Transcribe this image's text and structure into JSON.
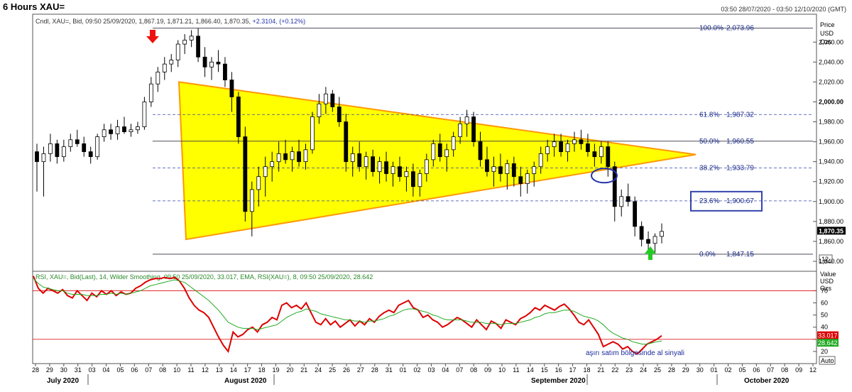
{
  "header": {
    "title": "6 Hours XAU=",
    "date_range": "03:50 28/07/2020 - 03:50 12/10/2020 (GMT)"
  },
  "chart_data": [
    {
      "type": "candlestick",
      "legend": {
        "prefix": "Cndl, XAU=, Bid, 09:50 25/09/2020, 1,867.19, 1,871.21, 1,866.40, 1,870.35,",
        "change": "+2.3104, (+0.12%)"
      },
      "axis_title": [
        "Price",
        "USD",
        "Ozs"
      ],
      "y_ticks": [
        "2,060.00",
        "2,040.00",
        "2,020.00",
        "2,000.00",
        "1,980.00",
        "1,960.00",
        "1,940.00",
        "1,920.00",
        "1,900.00",
        "1,880.00",
        "1,860.00",
        "1,840.00"
      ],
      "ylim": [
        1830,
        2088
      ],
      "last_price": "1,870.35",
      "scale_box": "12",
      "x_day_ticks": [
        "28",
        "29",
        "30",
        "31",
        "03",
        "04",
        "05",
        "06",
        "07",
        "08",
        "10",
        "11",
        "12",
        "13",
        "14",
        "17",
        "18",
        "19",
        "20",
        "21",
        "24",
        "25",
        "26",
        "27",
        "28",
        "31",
        "01",
        "02",
        "03",
        "04",
        "07",
        "08",
        "09",
        "10",
        "11",
        "14",
        "15",
        "16",
        "17",
        "18",
        "21",
        "22",
        "23",
        "24",
        "25",
        "28",
        "29",
        "30",
        "01",
        "02",
        "05",
        "06",
        "07",
        "08",
        "09",
        "12"
      ],
      "x_month_labels": [
        "July 2020",
        "August 2020",
        "September 2020",
        "October 2020"
      ],
      "fibonacci": [
        {
          "label": "100.0%",
          "price": 2073.96,
          "text": "2,073.96"
        },
        {
          "label": "61.8%",
          "price": 1987.32,
          "text": "1,987.32"
        },
        {
          "label": "50.0%",
          "price": 1960.55,
          "text": "1,960.55"
        },
        {
          "label": "38.2%",
          "price": 1933.79,
          "text": "1,933.79"
        },
        {
          "label": "23.6%",
          "price": 1900.67,
          "text": "1,900.67"
        },
        {
          "label": "0.0%",
          "price": 1847.15,
          "text": "1,847.15"
        }
      ],
      "triangle": {
        "top_left": 2020,
        "bottom_left": 1862,
        "tip": 1950
      },
      "candles": [
        [
          1950,
          1958,
          1910,
          1940
        ],
        [
          1940,
          1955,
          1905,
          1948
        ],
        [
          1948,
          1968,
          1940,
          1958
        ],
        [
          1958,
          1962,
          1938,
          1945
        ],
        [
          1945,
          1962,
          1940,
          1955
        ],
        [
          1955,
          1968,
          1950,
          1962
        ],
        [
          1962,
          1972,
          1955,
          1958
        ],
        [
          1958,
          1965,
          1945,
          1950
        ],
        [
          1950,
          1955,
          1938,
          1945
        ],
        [
          1945,
          1968,
          1942,
          1965
        ],
        [
          1965,
          1978,
          1960,
          1972
        ],
        [
          1972,
          1978,
          1962,
          1968
        ],
        [
          1968,
          1982,
          1962,
          1975
        ],
        [
          1975,
          1985,
          1968,
          1970
        ],
        [
          1970,
          1978,
          1965,
          1972
        ],
        [
          1972,
          1980,
          1968,
          1975
        ],
        [
          1975,
          2005,
          1972,
          2000
        ],
        [
          2000,
          2025,
          1995,
          2018
        ],
        [
          2018,
          2035,
          2010,
          2030
        ],
        [
          2030,
          2045,
          2022,
          2038
        ],
        [
          2038,
          2048,
          2030,
          2042
        ],
        [
          2042,
          2062,
          2035,
          2058
        ],
        [
          2058,
          2068,
          2048,
          2062
        ],
        [
          2062,
          2072,
          2055,
          2066
        ],
        [
          2066,
          2074,
          2040,
          2045
        ],
        [
          2045,
          2055,
          2025,
          2035
        ],
        [
          2035,
          2045,
          2022,
          2040
        ],
        [
          2040,
          2052,
          2030,
          2038
        ],
        [
          2038,
          2045,
          2015,
          2022
        ],
        [
          2022,
          2030,
          1990,
          2005
        ],
        [
          2005,
          2010,
          1958,
          1965
        ],
        [
          1965,
          1975,
          1880,
          1890
        ],
        [
          1890,
          1920,
          1865,
          1912
        ],
        [
          1912,
          1935,
          1895,
          1925
        ],
        [
          1925,
          1945,
          1905,
          1935
        ],
        [
          1935,
          1950,
          1920,
          1940
        ],
        [
          1940,
          1960,
          1930,
          1948
        ],
        [
          1948,
          1962,
          1938,
          1942
        ],
        [
          1942,
          1955,
          1930,
          1950
        ],
        [
          1950,
          1962,
          1935,
          1940
        ],
        [
          1940,
          1958,
          1932,
          1952
        ],
        [
          1952,
          1990,
          1948,
          1985
        ],
        [
          1985,
          2008,
          1978,
          1998
        ],
        [
          1998,
          2015,
          1988,
          2008
        ],
        [
          2008,
          2012,
          1990,
          1995
        ],
        [
          1995,
          2005,
          1975,
          1980
        ],
        [
          1980,
          1988,
          1930,
          1940
        ],
        [
          1940,
          1955,
          1925,
          1948
        ],
        [
          1948,
          1960,
          1930,
          1935
        ],
        [
          1935,
          1950,
          1922,
          1945
        ],
        [
          1945,
          1952,
          1925,
          1930
        ],
        [
          1930,
          1945,
          1918,
          1940
        ],
        [
          1940,
          1950,
          1920,
          1928
        ],
        [
          1928,
          1940,
          1915,
          1935
        ],
        [
          1935,
          1945,
          1920,
          1925
        ],
        [
          1925,
          1935,
          1910,
          1930
        ],
        [
          1930,
          1938,
          1905,
          1915
        ],
        [
          1915,
          1932,
          1905,
          1928
        ],
        [
          1928,
          1948,
          1920,
          1942
        ],
        [
          1942,
          1962,
          1935,
          1958
        ],
        [
          1958,
          1968,
          1940,
          1945
        ],
        [
          1945,
          1958,
          1930,
          1952
        ],
        [
          1952,
          1970,
          1945,
          1965
        ],
        [
          1965,
          1985,
          1958,
          1978
        ],
        [
          1978,
          1992,
          1965,
          1985
        ],
        [
          1985,
          1990,
          1955,
          1960
        ],
        [
          1960,
          1970,
          1935,
          1942
        ],
        [
          1942,
          1955,
          1925,
          1930
        ],
        [
          1930,
          1945,
          1915,
          1935
        ],
        [
          1935,
          1948,
          1920,
          1928
        ],
        [
          1928,
          1942,
          1912,
          1938
        ],
        [
          1938,
          1945,
          1915,
          1925
        ],
        [
          1925,
          1935,
          1905,
          1918
        ],
        [
          1918,
          1932,
          1908,
          1928
        ],
        [
          1928,
          1940,
          1915,
          1935
        ],
        [
          1935,
          1955,
          1928,
          1948
        ],
        [
          1948,
          1962,
          1940,
          1955
        ],
        [
          1955,
          1968,
          1945,
          1960
        ],
        [
          1960,
          1968,
          1945,
          1950
        ],
        [
          1950,
          1962,
          1940,
          1958
        ],
        [
          1958,
          1970,
          1950,
          1962
        ],
        [
          1962,
          1972,
          1952,
          1958
        ],
        [
          1958,
          1968,
          1945,
          1950
        ],
        [
          1950,
          1958,
          1935,
          1945
        ],
        [
          1945,
          1960,
          1938,
          1955
        ],
        [
          1955,
          1960,
          1925,
          1935
        ],
        [
          1935,
          1940,
          1880,
          1895
        ],
        [
          1895,
          1912,
          1885,
          1905
        ],
        [
          1905,
          1918,
          1895,
          1900
        ],
        [
          1900,
          1905,
          1865,
          1875
        ],
        [
          1875,
          1880,
          1855,
          1862
        ],
        [
          1862,
          1870,
          1850,
          1858
        ],
        [
          1858,
          1868,
          1848,
          1865
        ],
        [
          1865,
          1878,
          1858,
          1870
        ]
      ]
    },
    {
      "type": "line",
      "legend": {
        "prefix": "RSI, XAU=, Bid(Last),  14, Wilder Smoothing, 09:50 25/09/2020, 33.017, EMA, RSI(XAU=),  8, 09:50 25/09/2020, 28.642"
      },
      "axis_title": [
        "Value",
        "USD",
        "Ozs"
      ],
      "y_ticks": [
        "70",
        "60",
        "50",
        "40",
        "30",
        "20"
      ],
      "ylim": [
        10,
        86
      ],
      "reference_lines": [
        70,
        30
      ],
      "rsi_label": "33.017",
      "ema_label": "28.642",
      "scale_box": "Auto",
      "annotation": "aşırı satım bölgesinde al sinyali",
      "series": [
        {
          "color": "#dd0000",
          "values": [
            82,
            72,
            68,
            72,
            70,
            68,
            71,
            66,
            64,
            70,
            66,
            62,
            68,
            65,
            70,
            67,
            70,
            66,
            69,
            67,
            68,
            72,
            74,
            77,
            79,
            80,
            80,
            81,
            80,
            81,
            78,
            72,
            64,
            58,
            54,
            52,
            48,
            40,
            32,
            25,
            20,
            36,
            32,
            34,
            38,
            40,
            36,
            42,
            44,
            48,
            46,
            58,
            60,
            56,
            58,
            55,
            60,
            52,
            44,
            42,
            47,
            42,
            45,
            40,
            43,
            46,
            41,
            45,
            42,
            47,
            44,
            49,
            52,
            54,
            52,
            58,
            60,
            62,
            56,
            54,
            48,
            50,
            46,
            44,
            40,
            42,
            45,
            48,
            46,
            43,
            40,
            46,
            42,
            38,
            45,
            43,
            39,
            46,
            44,
            42,
            47,
            49,
            52,
            56,
            54,
            58,
            56,
            54,
            57,
            59,
            55,
            50,
            44,
            42,
            46,
            40,
            34,
            24,
            26,
            28,
            26,
            22,
            24,
            20,
            18,
            22,
            26,
            28,
            30,
            33
          ]
        },
        {
          "color": "#22aa22",
          "values": [
            80,
            76,
            73,
            72,
            71,
            70,
            70,
            68,
            67,
            67,
            67,
            66,
            66,
            66,
            67,
            67,
            68,
            67,
            68,
            67,
            68,
            69,
            70,
            72,
            74,
            75,
            76,
            77,
            78,
            79,
            78,
            77,
            74,
            71,
            68,
            65,
            62,
            58,
            54,
            49,
            44,
            42,
            40,
            39,
            39,
            39,
            38,
            39,
            40,
            41,
            42,
            45,
            48,
            50,
            52,
            53,
            55,
            54,
            53,
            51,
            50,
            49,
            48,
            47,
            46,
            46,
            45,
            45,
            44,
            45,
            45,
            46,
            47,
            49,
            50,
            52,
            54,
            55,
            55,
            54,
            53,
            52,
            50,
            49,
            47,
            46,
            46,
            46,
            46,
            45,
            44,
            44,
            44,
            43,
            43,
            43,
            42,
            43,
            43,
            43,
            44,
            45,
            46,
            48,
            49,
            51,
            52,
            52,
            53,
            54,
            54,
            53,
            51,
            49,
            48,
            47,
            45,
            42,
            38,
            35,
            33,
            31,
            30,
            28,
            27,
            26,
            26,
            27,
            28,
            28.6
          ]
        }
      ]
    }
  ]
}
